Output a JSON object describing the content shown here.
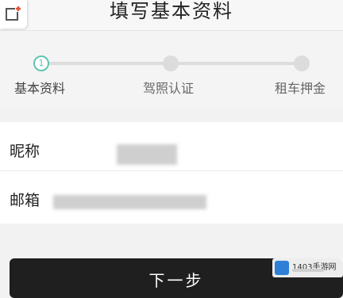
{
  "header": {
    "title": "填写基本资料",
    "corner_icon": "add-window-icon"
  },
  "steps": {
    "active_index": 0,
    "active_number": "1",
    "items": [
      {
        "label": "基本资料"
      },
      {
        "label": "驾照认证"
      },
      {
        "label": "租车押金"
      }
    ]
  },
  "form": {
    "nickname": {
      "label": "昵称"
    },
    "email": {
      "label": "邮箱"
    }
  },
  "actions": {
    "next_label": "下一步"
  },
  "watermark": {
    "text": "1403手游网"
  },
  "colors": {
    "accent": "#5fc4b3",
    "button": "#1f1f1f"
  }
}
